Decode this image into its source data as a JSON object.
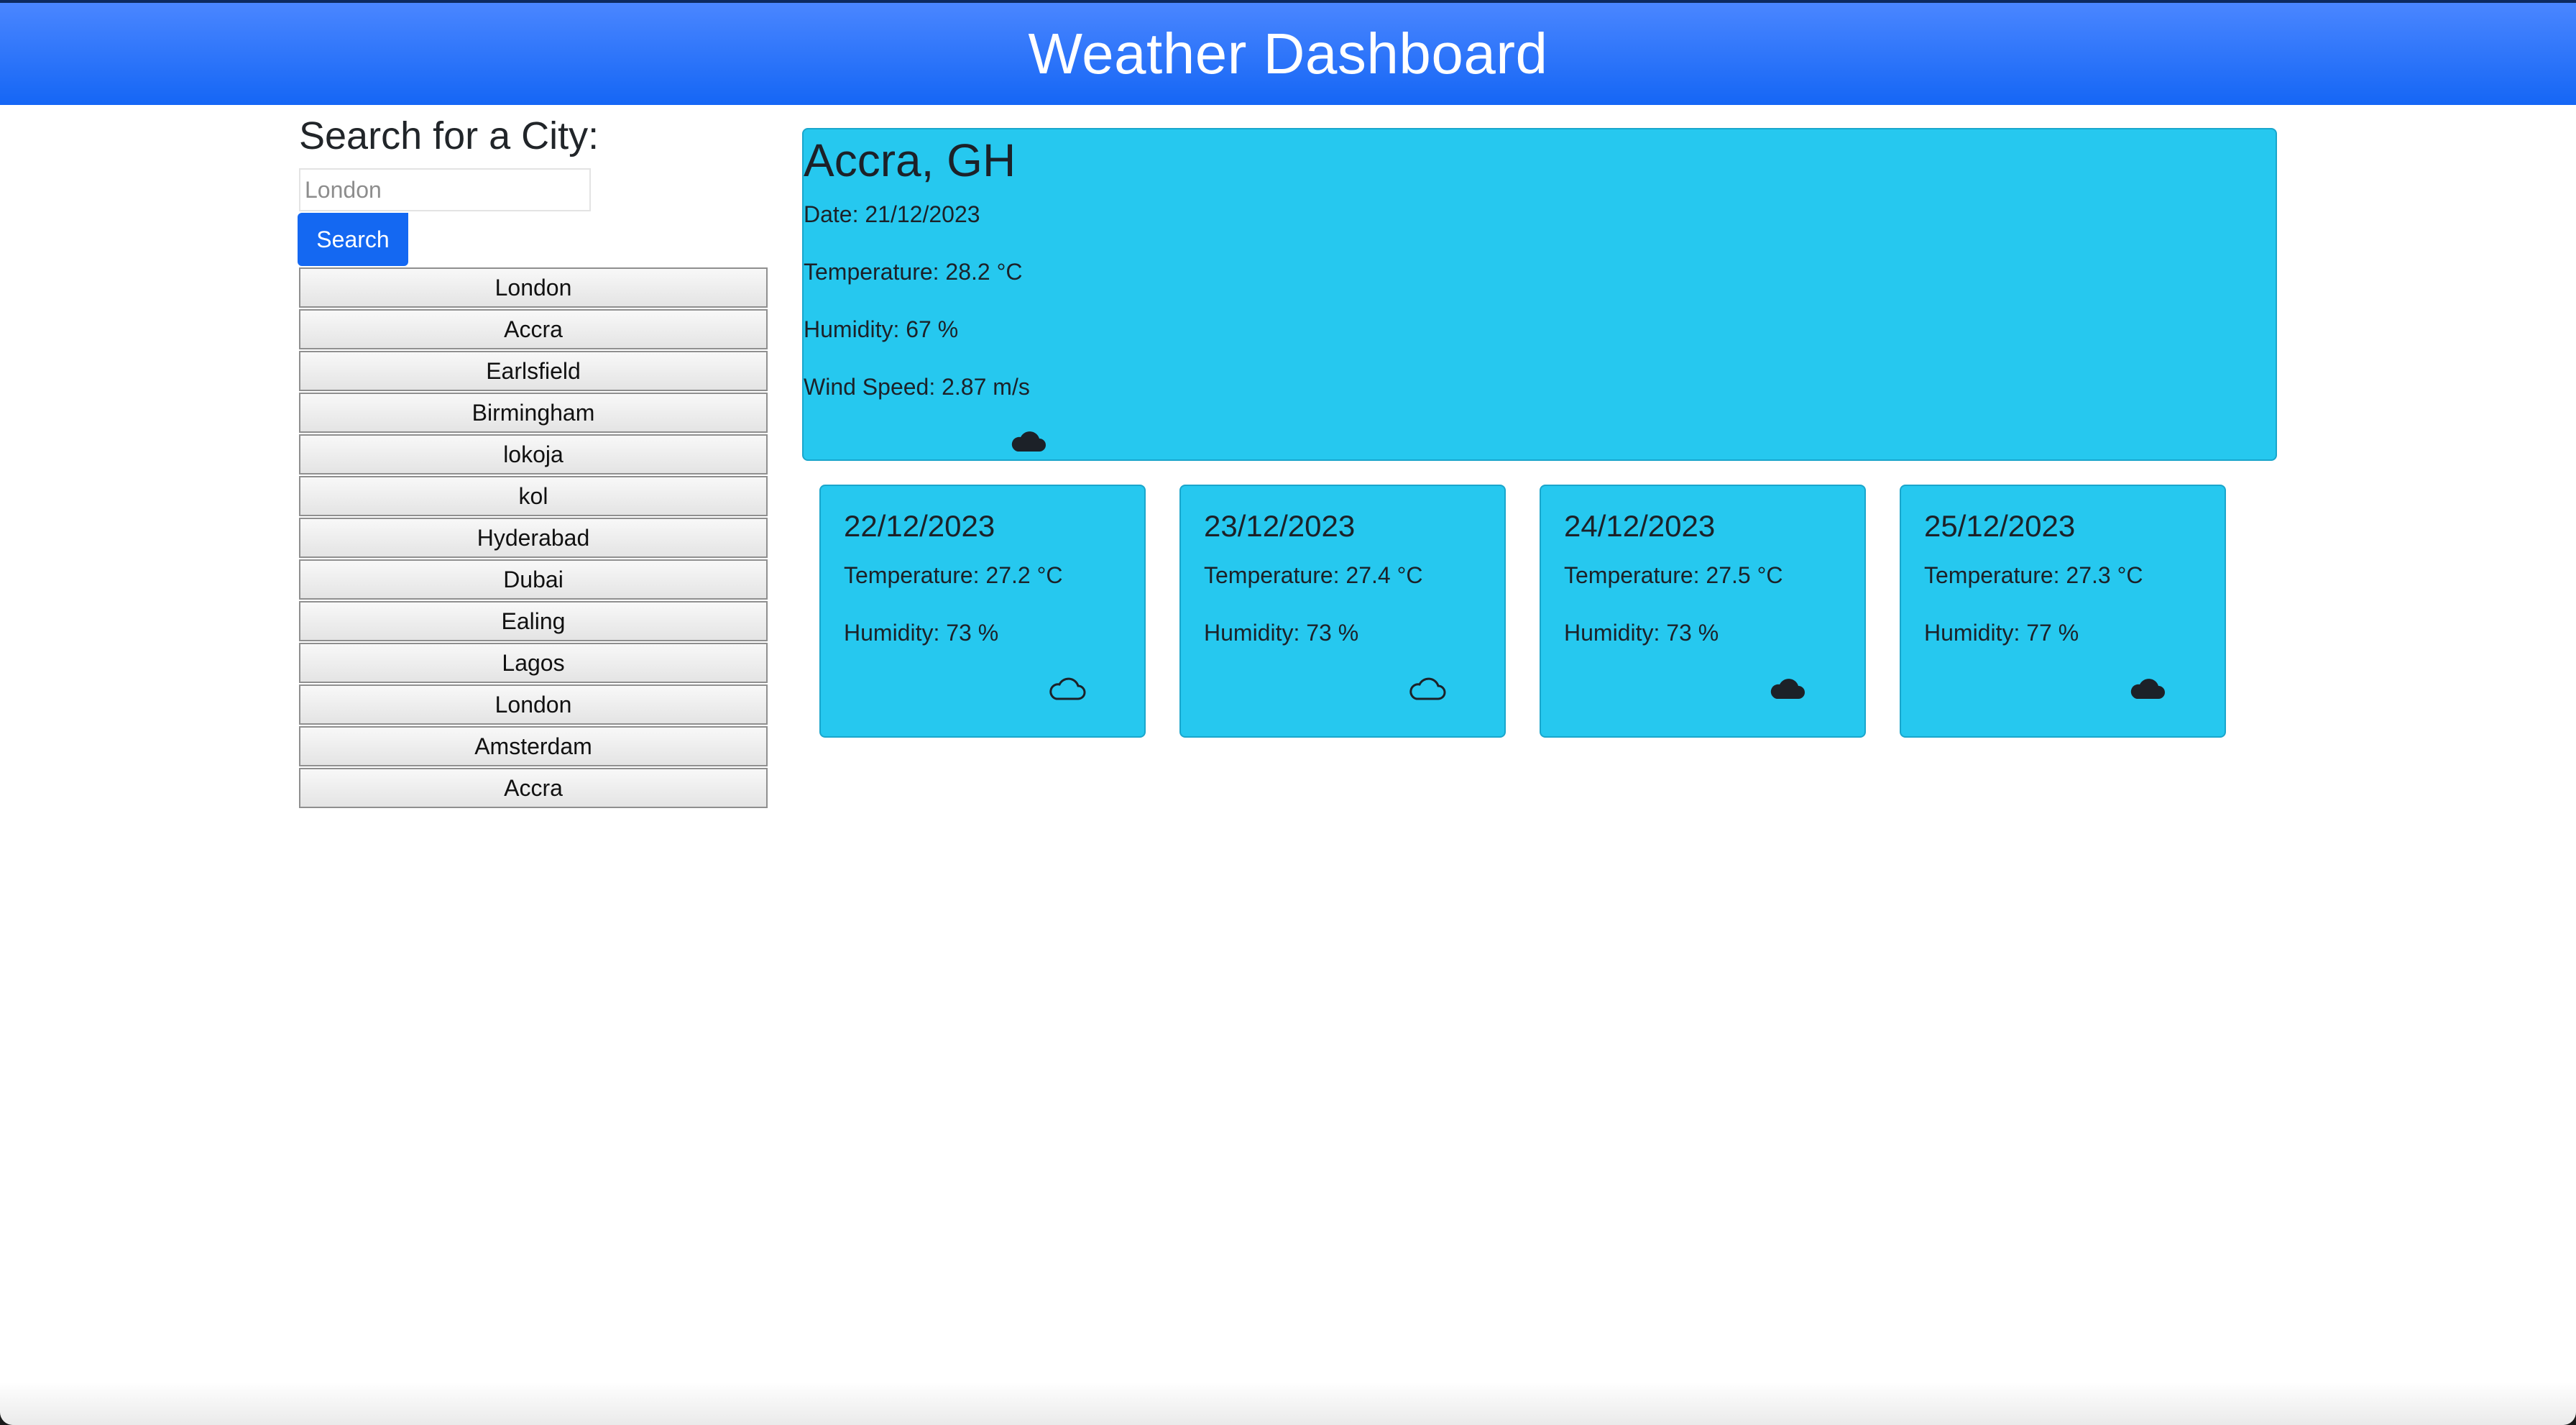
{
  "header": {
    "title": "Weather Dashboard"
  },
  "search": {
    "title": "Search for a City:",
    "placeholder": "London",
    "button_label": "Search"
  },
  "history": [
    "London",
    "Accra",
    "Earlsfield",
    "Birmingham",
    "lokoja",
    "kol",
    "Hyderabad",
    "Dubai",
    "Ealing",
    "Lagos",
    "London",
    "Amsterdam",
    "Accra"
  ],
  "current": {
    "city": "Accra, GH",
    "date": "Date: 21/12/2023",
    "temperature": "Temperature: 28.2 °C",
    "humidity": "Humidity: 67 %",
    "wind": "Wind Speed: 2.87 m/s",
    "icon": "cloud-filled-icon"
  },
  "forecast": [
    {
      "date": "22/12/2023",
      "temperature": "Temperature: 27.2 °C",
      "humidity": "Humidity: 73 %",
      "icon": "cloud-outline-icon"
    },
    {
      "date": "23/12/2023",
      "temperature": "Temperature: 27.4 °C",
      "humidity": "Humidity: 73 %",
      "icon": "cloud-outline-icon"
    },
    {
      "date": "24/12/2023",
      "temperature": "Temperature: 27.5 °C",
      "humidity": "Humidity: 73 %",
      "icon": "cloud-filled-icon"
    },
    {
      "date": "25/12/2023",
      "temperature": "Temperature: 27.3 °C",
      "humidity": "Humidity: 77 %",
      "icon": "cloud-filled-icon"
    }
  ],
  "colors": {
    "header": "#1566f5",
    "card": "#26c8ef",
    "button": "#1468f2"
  }
}
